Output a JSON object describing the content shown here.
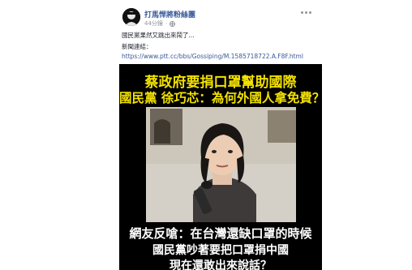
{
  "post": {
    "page_name": "打馬悍將粉絲團",
    "time": "44分鐘",
    "privacy_icon": "globe-icon",
    "caption": "國民黨果然又跳出來鬧了...",
    "news_label": "新聞連結：",
    "link_text": "https://www.ptt.cc/bbs/Gossiping/M.1585718722.A.F8F.html"
  },
  "image": {
    "headline_1": "蔡政府要捐口罩幫助國際",
    "headline_2": "國民黨 徐巧芯：為何外國人拿免費？",
    "quote_1": "網友反嗆：在台灣還缺口罩的時候",
    "quote_2": "國民黨吵著要把口罩捐中國",
    "quote_3": "現在還敢出來說話？"
  },
  "colors": {
    "link": "#385898",
    "headline": "#f2e100",
    "media_background": "#000000"
  }
}
